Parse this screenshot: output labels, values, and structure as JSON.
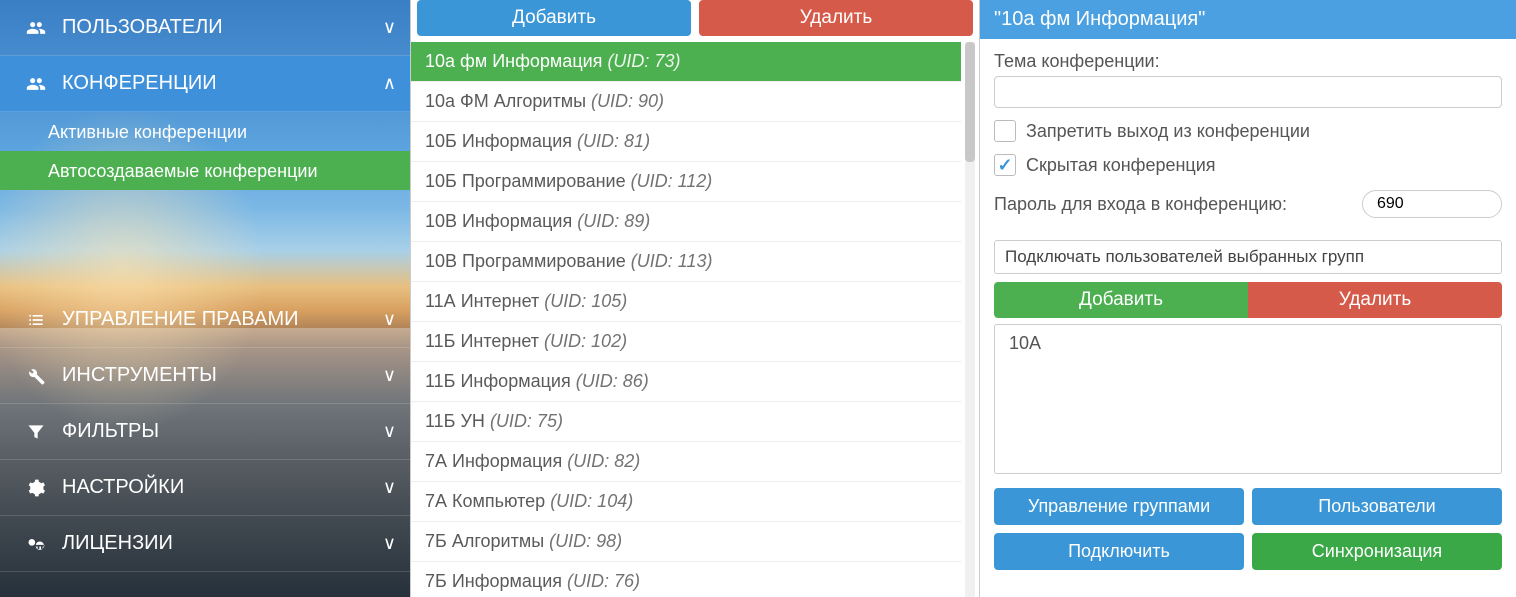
{
  "sidebar": {
    "items": [
      {
        "label": "ПОЛЬЗОВАТЕЛИ",
        "icon": "users",
        "expanded": false,
        "sub": []
      },
      {
        "label": "КОНФЕРЕНЦИИ",
        "icon": "users",
        "expanded": true,
        "sub": [
          {
            "label": "Активные конференции",
            "active": false
          },
          {
            "label": "Автосоздаваемые конференции",
            "active": true
          }
        ]
      },
      {
        "label": "УПРАВЛЕНИЕ ПРАВАМИ",
        "icon": "list",
        "expanded": false,
        "sub": []
      },
      {
        "label": "ИНСТРУМЕНТЫ",
        "icon": "wrench",
        "expanded": false,
        "sub": []
      },
      {
        "label": "ФИЛЬТРЫ",
        "icon": "filter",
        "expanded": false,
        "sub": []
      },
      {
        "label": "НАСТРОЙКИ",
        "icon": "gears",
        "expanded": false,
        "sub": []
      },
      {
        "label": "ЛИЦЕНЗИИ",
        "icon": "key",
        "expanded": false,
        "sub": []
      }
    ]
  },
  "middle": {
    "add_label": "Добавить",
    "delete_label": "Удалить",
    "rows": [
      {
        "name": "10а фм Информация",
        "uid": "73",
        "selected": true
      },
      {
        "name": "10а ФМ Алгоритмы",
        "uid": "90"
      },
      {
        "name": "10Б Информация",
        "uid": "81"
      },
      {
        "name": "10Б Программирование",
        "uid": "112"
      },
      {
        "name": "10В Информация",
        "uid": "89"
      },
      {
        "name": "10В Программирование",
        "uid": "113"
      },
      {
        "name": "11А Интернет",
        "uid": "105"
      },
      {
        "name": "11Б Интернет",
        "uid": "102"
      },
      {
        "name": "11Б Информация",
        "uid": "86"
      },
      {
        "name": "11Б УН",
        "uid": "75"
      },
      {
        "name": "7А Информация",
        "uid": "82"
      },
      {
        "name": "7А Компьютер",
        "uid": "104"
      },
      {
        "name": "7Б Алгоритмы",
        "uid": "98"
      },
      {
        "name": "7Б Информация",
        "uid": "76"
      }
    ]
  },
  "right": {
    "header": "\"10а фм Информация\"",
    "topic_label": "Тема конференции:",
    "topic_value": "",
    "deny_exit_label": "Запретить выход из конференции",
    "deny_exit_checked": false,
    "hidden_label": "Скрытая конференция",
    "hidden_checked": true,
    "password_label": "Пароль для входа в конференцию:",
    "password_value": "690",
    "dropdown_value": "Подключать пользователей выбранных групп",
    "add_label": "Добавить",
    "delete_label": "Удалить",
    "groups": [
      "10А"
    ],
    "manage_groups_label": "Управление группами",
    "users_label": "Пользователи",
    "connect_label": "Подключить",
    "sync_label": "Синхронизация"
  }
}
